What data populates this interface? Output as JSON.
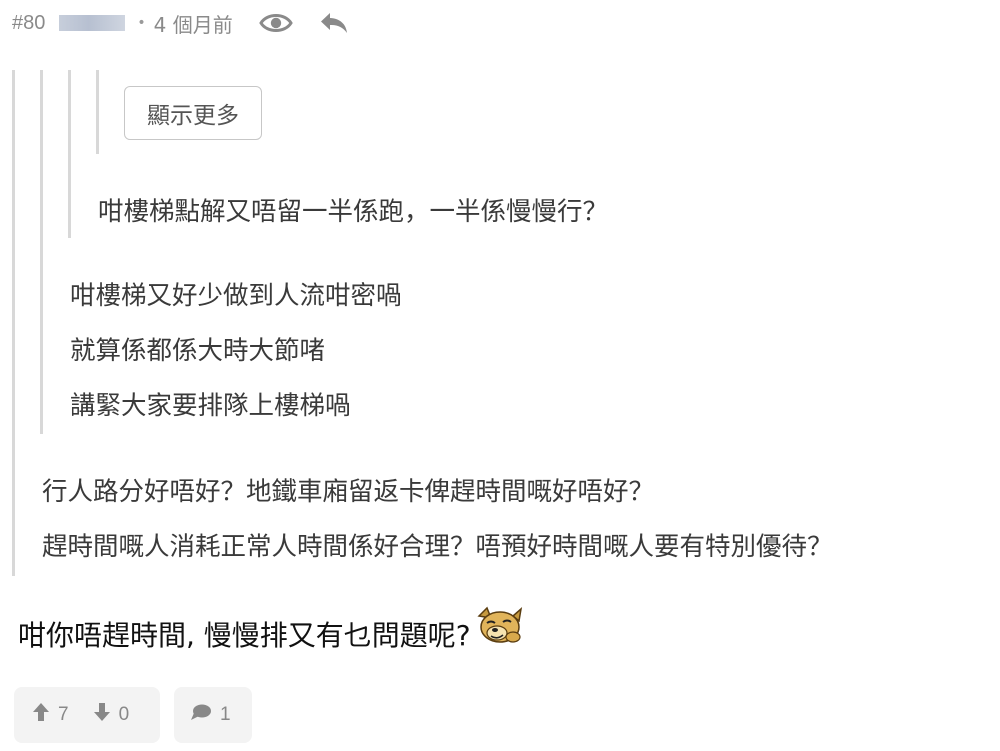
{
  "post": {
    "number": "#80",
    "time_ago": "4 個月前",
    "separator": "•",
    "icons": {
      "view": "eye-icon",
      "reply": "reply-arrow-icon"
    }
  },
  "quote": {
    "show_more_label": "顯示更多",
    "level3_text": "咁樓梯點解又唔留一半係跑，一半係慢慢行？",
    "level2_lines": [
      "咁樓梯又好少做到人流咁密喎",
      "就算係都係大時大節啫",
      "講緊大家要排隊上樓梯喎"
    ],
    "level1_lines": [
      "行人路分好唔好？地鐵車廂留返卡俾趕時間嘅好唔好？",
      "趕時間嘅人消耗正常人時間係好合理？唔預好時間嘅人要有特別優待？"
    ]
  },
  "reply_text": "咁你唔趕時間, 慢慢排又有乜問題呢?",
  "emoji_icon": "dog-smug-emoji-icon",
  "actions": {
    "upvotes": "7",
    "downvotes": "0",
    "replies": "1",
    "icons": {
      "upvote": "arrow-up-icon",
      "downvote": "arrow-down-icon",
      "comment": "comment-bubble-icon"
    }
  },
  "colors": {
    "meta_gray": "#8a8a8a",
    "quote_bar": "#d8d8d8",
    "quote_text": "#3a3a3a",
    "pill_bg": "#f3f3f3"
  }
}
